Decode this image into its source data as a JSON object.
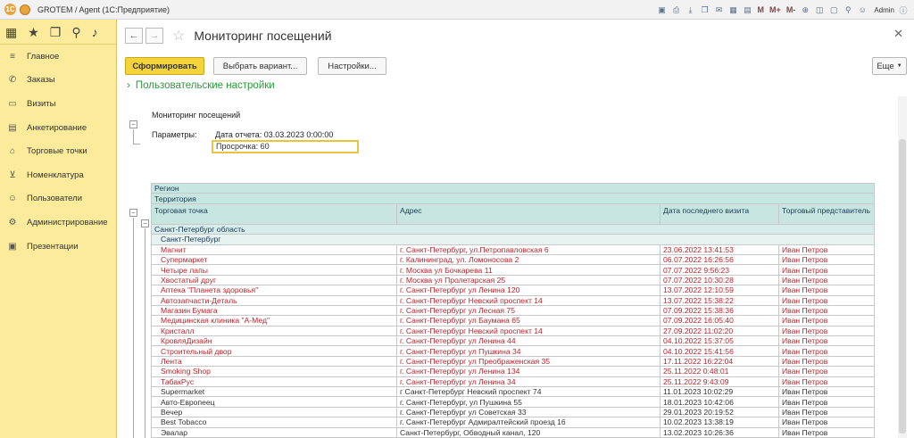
{
  "app": {
    "logo_text": "1С",
    "title": "GROTEM / Agent  (1С:Предприятие)",
    "toolbar_icons": [
      "save-icon",
      "print-icon",
      "download-icon",
      "copy-icon",
      "mail-icon",
      "table-icon",
      "calendar-icon"
    ],
    "m_buttons": [
      "M",
      "M+",
      "M-"
    ],
    "user": "Admin"
  },
  "sidebar": {
    "top_icons": [
      "grid-icon",
      "star-icon",
      "history-icon",
      "search-icon",
      "bell-icon"
    ],
    "items": [
      {
        "label": "Главное",
        "icon": "menu-icon",
        "glyph": "≡"
      },
      {
        "label": "Заказы",
        "icon": "phone-icon",
        "glyph": "✆"
      },
      {
        "label": "Визиты",
        "icon": "car-icon",
        "glyph": "▭"
      },
      {
        "label": "Анкетирование",
        "icon": "clipboard-icon",
        "glyph": "▤"
      },
      {
        "label": "Торговые точки",
        "icon": "store-icon",
        "glyph": "⌂"
      },
      {
        "label": "Номенклатура",
        "icon": "cart-icon",
        "glyph": "⊻"
      },
      {
        "label": "Пользователи",
        "icon": "users-icon",
        "glyph": "☺"
      },
      {
        "label": "Администрирование",
        "icon": "gear-icon",
        "glyph": "⚙"
      },
      {
        "label": "Презентации",
        "icon": "image-icon",
        "glyph": "▣"
      }
    ]
  },
  "page": {
    "title": "Мониторинг посещений",
    "buttons": {
      "generate": "Сформировать",
      "select_variant": "Выбрать вариант...",
      "settings": "Настройки...",
      "more": "Еще"
    },
    "user_settings_link": "Пользовательские настройки"
  },
  "report": {
    "title": "Мониторинг посещений",
    "params_label": "Параметры:",
    "report_date": "Дата отчета: 03.03.2023 0:00:00",
    "overdue": "Просрочка: 60",
    "header_rows": [
      "Регион",
      "Территория"
    ],
    "columns": [
      "Торговая точка",
      "Адрес",
      "Дата последнего визита",
      "Торговый представитель"
    ],
    "region": "Санкт-Петербург область",
    "territory": "Санкт-Петербург",
    "rows": [
      {
        "name": "Магнит",
        "address": "г. Санкт-Петербург, ул.Петропавловская 6",
        "date": "23.06.2022 13:41:53",
        "rep": "Иван Петров",
        "overdue": true
      },
      {
        "name": "Супермаркет",
        "address": "г. Калининград, ул. Ломоносова 2",
        "date": "06.07.2022 16:26:56",
        "rep": "Иван Петров",
        "overdue": true
      },
      {
        "name": "Четыре лапы",
        "address": "г. Москва ул Бочкарева 11",
        "date": "07.07.2022 9:56:23",
        "rep": "Иван Петров",
        "overdue": true
      },
      {
        "name": "Хвостатый друг",
        "address": "г. Москва ул Пролетарская 25",
        "date": "07.07.2022 10:30:28",
        "rep": "Иван Петров",
        "overdue": true
      },
      {
        "name": "Аптека \"Планета здоровья\"",
        "address": "г. Санкт-Петербург ул Ленина 120",
        "date": "13.07.2022 12:10:59",
        "rep": "Иван Петров",
        "overdue": true
      },
      {
        "name": "Автозапчасти-Деталь",
        "address": "г. Санкт-Петербург Невский проспект 14",
        "date": "13.07.2022 15:38:22",
        "rep": "Иван Петров",
        "overdue": true
      },
      {
        "name": "Магазин Бумага",
        "address": "г. Санкт-Петербург ул Лесная 75",
        "date": "07.09.2022 15:38:36",
        "rep": "Иван Петров",
        "overdue": true
      },
      {
        "name": "Медицинская клиника \"А-Мед\"",
        "address": "г. Санкт-Петербург ул Баумана 65",
        "date": "07.09.2022 16:05:40",
        "rep": "Иван Петров",
        "overdue": true
      },
      {
        "name": "Кристалл",
        "address": "г. Санкт-Петербург Невский проспект 14",
        "date": "27.09.2022 11:02:20",
        "rep": "Иван Петров",
        "overdue": true
      },
      {
        "name": "КровляДизайн",
        "address": "г. Санкт-Петербург ул Ленина 44",
        "date": "04.10.2022 15:37:05",
        "rep": "Иван Петров",
        "overdue": true
      },
      {
        "name": "Строительный двор",
        "address": "г. Санкт-Петербург ул Пушкина 34",
        "date": "04.10.2022 15:41:56",
        "rep": "Иван Петров",
        "overdue": true
      },
      {
        "name": "Лента",
        "address": "г. Санкт-Петербург ул Преображенская 35",
        "date": "17.11.2022 16:22:04",
        "rep": "Иван Петров",
        "overdue": true
      },
      {
        "name": "Smoking Shop",
        "address": "г. Санкт-Петербург ул Ленина 134",
        "date": "25.11.2022 0:48:01",
        "rep": "Иван Петров",
        "overdue": true
      },
      {
        "name": "ТабакРус",
        "address": "г. Санкт-Петербург ул Ленина 34",
        "date": "25.11.2022 9:43:09",
        "rep": "Иван Петров",
        "overdue": true
      },
      {
        "name": "Supermarket",
        "address": "г Санкт-Петербург Невский проспект 74",
        "date": "11.01.2023 10:02:29",
        "rep": "Иван Петров",
        "overdue": false
      },
      {
        "name": "Авто-Европеец",
        "address": "г. Санкт-Петербург, ул Пушкина 55",
        "date": "18.01.2023 10:42:06",
        "rep": "Иван Петров",
        "overdue": false
      },
      {
        "name": "Вечер",
        "address": "г. Санкт-Петербург ул Советская 33",
        "date": "29.01.2023 20:19:52",
        "rep": "Иван Петров",
        "overdue": false
      },
      {
        "name": "Best Tobacco",
        "address": "г. Санкт-Петербург Адмиралтейский проезд 16",
        "date": "10.02.2023 13:38:19",
        "rep": "Иван Петров",
        "overdue": false
      },
      {
        "name": "Эвалар",
        "address": "Санкт-Петербург, Обводный канал, 120",
        "date": "13.02.2023 10:26:36",
        "rep": "Иван Петров",
        "overdue": false
      }
    ]
  },
  "colors": {
    "accent": "#f5d33b",
    "sidebar": "#fbeb9a",
    "header_bg": "#c7e6e0",
    "overdue_text": "#b8252c",
    "link": "#2a9a3a"
  }
}
